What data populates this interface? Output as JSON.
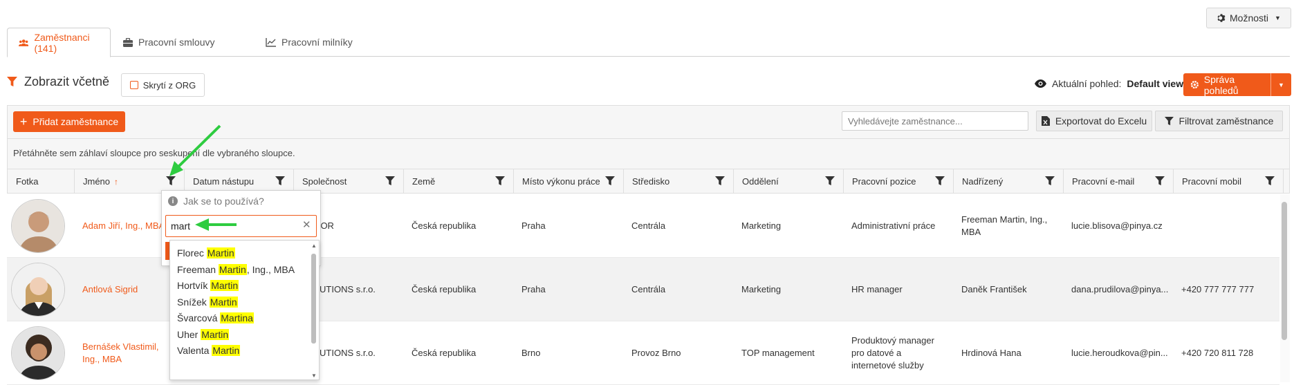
{
  "header": {
    "options_label": "Možnosti"
  },
  "tabs": [
    {
      "label": "Zaměstnanci (141)"
    },
    {
      "label": "Pracovní smlouvy"
    },
    {
      "label": "Pracovní milníky"
    }
  ],
  "filter_bar": {
    "title": "Zobrazit včetně",
    "hide_org_label": "Skrytí z ORG",
    "current_view_prefix": "Aktuální pohled:",
    "current_view_value": "Default view",
    "manage_views_label": "Správa pohledů"
  },
  "toolbar": {
    "add_label": "Přidat zaměstnance",
    "search_placeholder": "Vyhledávejte zaměstnance...",
    "export_label": "Exportovat do Excelu",
    "filter_label": "Filtrovat zaměstnance"
  },
  "group_hint": "Přetáhněte sem záhlaví sloupce pro seskupení dle vybraného sloupce.",
  "columns": [
    "Fotka",
    "Jméno",
    "Datum nástupu",
    "Společnost",
    "Země",
    "Místo výkonu práce",
    "Středisko",
    "Oddělení",
    "Pracovní pozice",
    "Nadřízený",
    "Pracovní e-mail",
    "Pracovní mobil"
  ],
  "rows": [
    {
      "name": "Adam Jiří, Ing., MBA",
      "company": "TDOOR",
      "country": "Česká republika",
      "place": "Praha",
      "center": "Centrála",
      "department": "Marketing",
      "position": "Administrativní práce",
      "manager": "Freeman Martin, Ing., MBA",
      "email": "lucie.blisova@pinya.cz",
      "mobile": ""
    },
    {
      "name": "Antlová Sigrid",
      "company": "SOLUTIONS s.r.o.",
      "country": "Česká republika",
      "place": "Praha",
      "center": "Centrála",
      "department": "Marketing",
      "position": "HR manager",
      "manager": "Daněk František",
      "email": "dana.prudilova@pinya...",
      "mobile": "+420 777 777 777"
    },
    {
      "name": "Bernášek Vlastimil, Ing., MBA",
      "company": "SOLUTIONS s.r.o.",
      "country": "Česká republika",
      "place": "Brno",
      "center": "Provoz Brno",
      "department": "TOP management",
      "position": "Produktový manager pro datové a internetové služby",
      "manager": "Hrdinová Hana",
      "email": "lucie.heroudkova@pin...",
      "mobile": "+420 720 811 728"
    }
  ],
  "filter_popup": {
    "help_text": "Jak se to používá?",
    "input_value": "mart",
    "suggestions": [
      {
        "before": "Florec ",
        "match": "Martin",
        "after": ""
      },
      {
        "before": "Freeman ",
        "match": "Martin",
        "after": ", Ing., MBA"
      },
      {
        "before": "Hortvík ",
        "match": "Martin",
        "after": ""
      },
      {
        "before": "Snížek ",
        "match": "Martin",
        "after": ""
      },
      {
        "before": "Švarcová ",
        "match": "Martina",
        "after": ""
      },
      {
        "before": "Uher ",
        "match": "Martin",
        "after": ""
      },
      {
        "before": "Valenta ",
        "match": "Martin",
        "after": ""
      }
    ]
  },
  "colors": {
    "accent": "#f05a1a",
    "highlight": "#ffff00",
    "annotation_arrow": "#2ecc40"
  }
}
